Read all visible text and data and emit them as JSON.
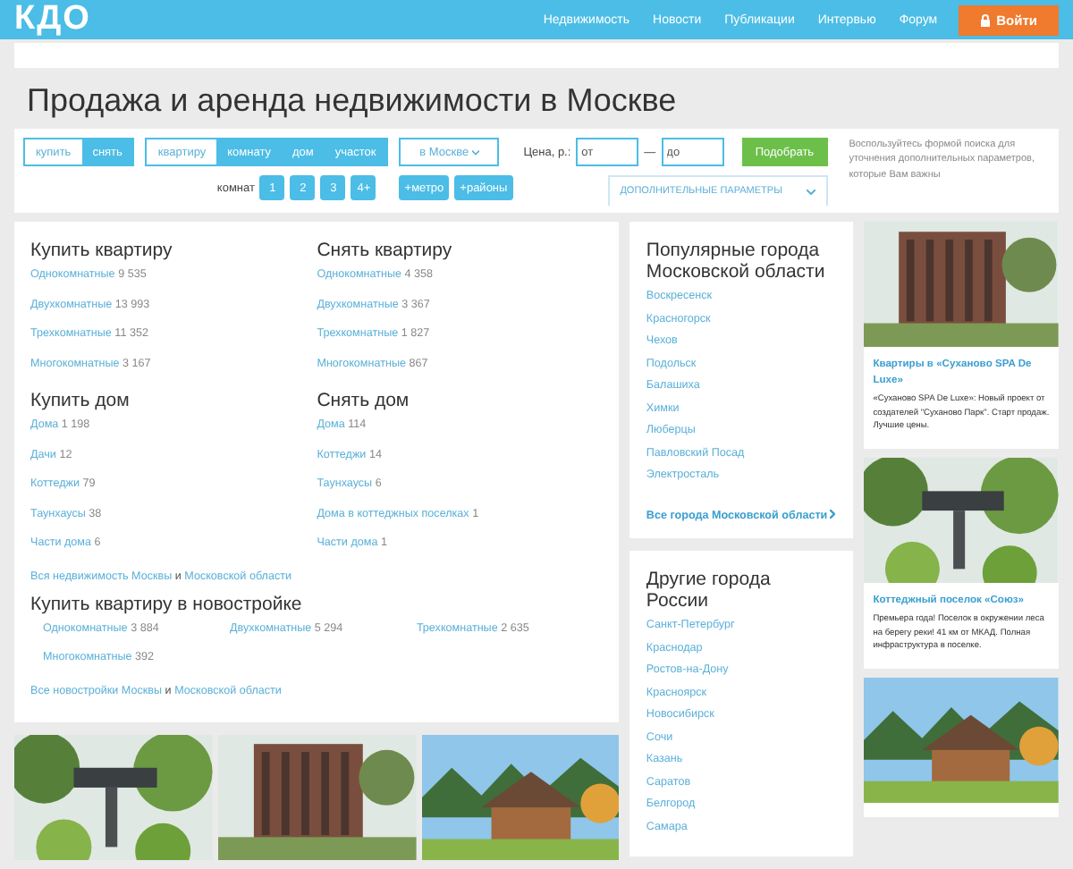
{
  "header": {
    "logo": "КДО",
    "nav": [
      "Недвижимость",
      "Новости",
      "Публикации",
      "Интервью",
      "Форум"
    ],
    "login": "Войти"
  },
  "title": "Продажа и аренда недвижимости в Москве",
  "filter": {
    "deal": [
      {
        "label": "купить",
        "selected": false
      },
      {
        "label": "снять",
        "selected": true
      }
    ],
    "type": [
      {
        "label": "квартиру",
        "selected": false
      },
      {
        "label": "комнату",
        "selected": true
      },
      {
        "label": "дом",
        "selected": true
      },
      {
        "label": "участок",
        "selected": true
      }
    ],
    "rooms_label": "комнат",
    "rooms": [
      "1",
      "2",
      "3",
      "4+"
    ],
    "city": "в Москве",
    "metro": "+метро",
    "districts": "+районы",
    "price_label": "Цена, р.:",
    "price_from": {
      "placeholder": "от"
    },
    "dash": "—",
    "price_to": {
      "placeholder": "до"
    },
    "submit": "Подобрать",
    "more": "ДОПОЛНИТЕЛЬНЫЕ ПАРАМЕТРЫ",
    "hint": "Воспользуйтесь формой поиска для уточнения дополнительных параметров, которые Вам важны"
  },
  "sections": [
    {
      "title": "Купить квартиру",
      "links": [
        {
          "label": "Однокомнатные",
          "count": "9 535"
        },
        {
          "label": "Двухкомнатные",
          "count": "13 993"
        },
        {
          "label": "Трехкомнатные",
          "count": "11 352"
        },
        {
          "label": "Многокомнатные",
          "count": "3 167"
        }
      ]
    },
    {
      "title": "Снять квартиру",
      "links": [
        {
          "label": "Однокомнатные",
          "count": "4 358"
        },
        {
          "label": "Двухкомнатные",
          "count": "3 367"
        },
        {
          "label": "Трехкомнатные",
          "count": "1 827"
        },
        {
          "label": "Многокомнатные",
          "count": "867"
        }
      ]
    },
    {
      "title": "Купить дом",
      "links": [
        {
          "label": "Дома",
          "count": "1 198"
        },
        {
          "label": "Дачи",
          "count": "12"
        },
        {
          "label": "Коттеджи",
          "count": "79"
        },
        {
          "label": "Таунхаусы",
          "count": "38"
        },
        {
          "label": "Части дома",
          "count": "6"
        }
      ]
    },
    {
      "title": "Снять дом",
      "links": [
        {
          "label": "Дома",
          "count": "114"
        },
        {
          "label": "Коттеджи",
          "count": "14"
        },
        {
          "label": "Таунхаусы",
          "count": "6"
        },
        {
          "label": "Дома в коттеджных поселках",
          "count": "1"
        },
        {
          "label": "Части дома",
          "count": "1"
        }
      ]
    }
  ],
  "all_link": {
    "first": "Вся недвижимость Москвы",
    "joiner": "и",
    "second": "Московской области"
  },
  "newbuild": {
    "title": "Купить квартиру в новостройке",
    "links": [
      {
        "label": "Однокомнатные",
        "count": "3 884"
      },
      {
        "label": "Двухкомнатные",
        "count": "5 294"
      },
      {
        "label": "Трехкомнатные",
        "count": "2 635"
      },
      {
        "label": "Многокомнатные",
        "count": "392"
      }
    ],
    "all_link": {
      "first": "Все новостройки Москвы",
      "joiner": "и",
      "second": "Московской области"
    }
  },
  "popular": {
    "title": "Популярные города Московской области",
    "links": [
      "Воскресенск",
      "Красногорск",
      "Чехов",
      "Подольск",
      "Балашиха",
      "Химки",
      "Люберцы",
      "Павловский Посад",
      "Электросталь"
    ],
    "more": "Все города Московской области"
  },
  "other": {
    "title": "Другие города России",
    "links": [
      "Санкт-Петербург",
      "Краснодар",
      "Ростов-на-Дону",
      "Красноярск",
      "Новосибирск",
      "Сочи",
      "Казань",
      "Саратов",
      "Белгород",
      "Самара"
    ]
  },
  "ads": [
    {
      "kind": "building",
      "title": "Квартиры в «Сухановo SPA De Luxe»",
      "text": "«Суханово SPA De Luxe»: Новый проект от создателей \"Суханово Парк\". Старт продаж. Лучшие цены."
    },
    {
      "kind": "forest",
      "title": "Коттеджный поселок «Союз»",
      "text": "Премьера года! Поселок в окружении леса на берегу реки! 41 км от МКАД. Полная инфраструктура в поселке."
    },
    {
      "kind": "house"
    }
  ],
  "bottom_pictures": [
    {
      "kind": "forest"
    },
    {
      "kind": "building"
    },
    {
      "kind": "house"
    }
  ]
}
